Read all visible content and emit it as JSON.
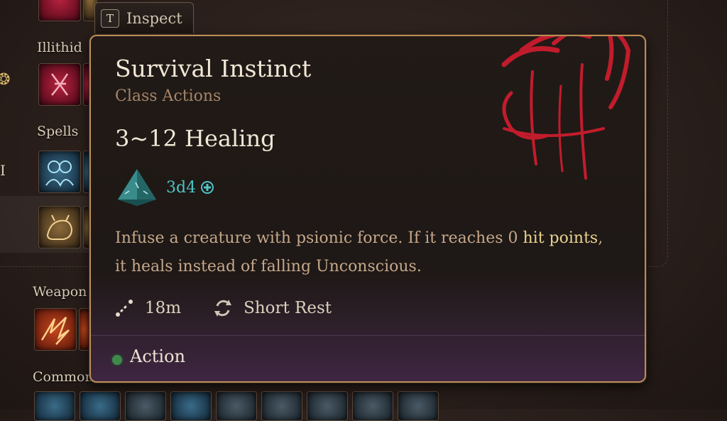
{
  "hotbar": {
    "sections": {
      "illithid": "Illithid",
      "spells": "Spells",
      "weapon": "Weapon",
      "common": "Common"
    }
  },
  "inspect": {
    "key": "T",
    "label": "Inspect"
  },
  "tooltip": {
    "title": "Survival Instinct",
    "subtitle": "Class Actions",
    "heal": "3~12 Healing",
    "dice": "3d4",
    "description_part1": "Infuse a creature with psionic force. If it reaches 0 ",
    "description_highlight": "hit points",
    "description_part2": ",",
    "description_line2": "it heals instead of falling Unconscious.",
    "range": "18m",
    "rest": "Short Rest",
    "cost": "Action"
  },
  "colors": {
    "frame": "#b98d57",
    "dice_text": "#4fc3c4",
    "highlight": "#e8d38e",
    "action_dot": "#3f8a4a",
    "claw": "#c21c2c"
  },
  "icons": [
    "claw-icon",
    "dice-icon",
    "plus-icon",
    "range-icon",
    "short-rest-icon"
  ]
}
